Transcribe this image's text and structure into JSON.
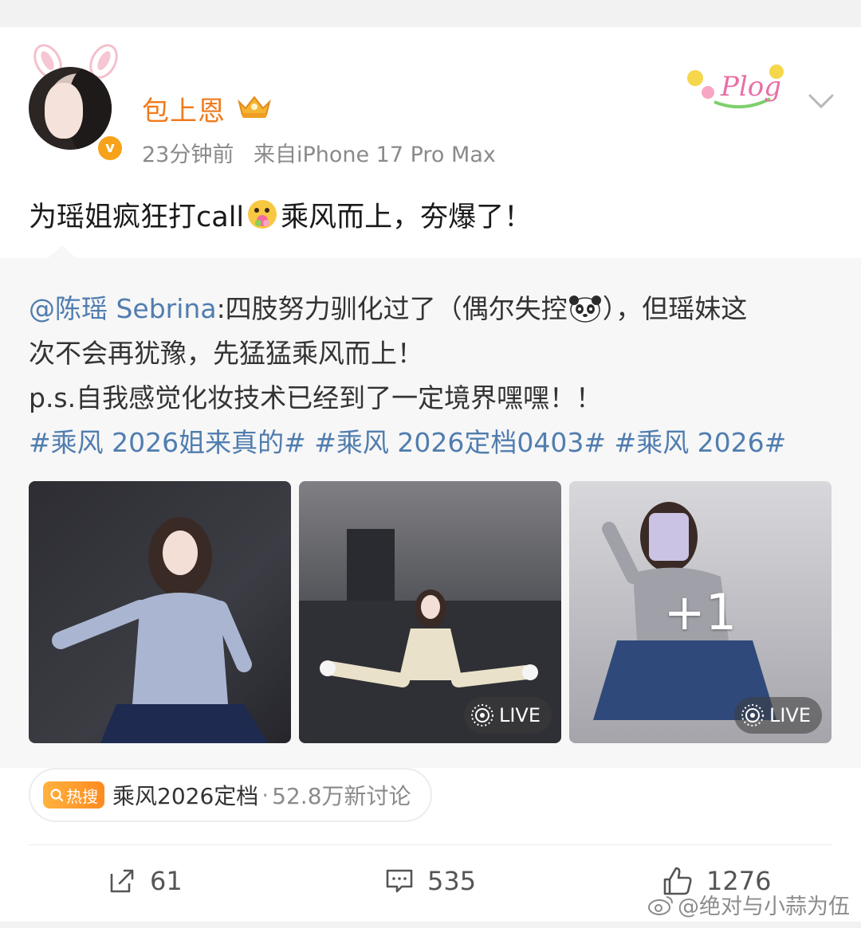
{
  "author": {
    "name": "包上恩",
    "verified": true,
    "time": "23分钟前",
    "source": "来自iPhone 17 Pro Max"
  },
  "post": {
    "text_before_emoji": "为瑶姐疯狂打call",
    "text_after_emoji": "乘风而上，夯爆了！",
    "emoji": "face-with-flowers-emoji"
  },
  "repost": {
    "mention": "@陈瑶 Sebrina",
    "line1_text": ":四肢努力驯化过了（偶尔失控",
    "line1_end": "），但瑶妹这",
    "line2": "次不会再犹豫，先猛猛乘风而上！",
    "line3": "p.s.自我感觉化妆技术已经到了一定境界嘿嘿！！",
    "hashtags": [
      "#乘风 2026姐来真的#",
      "#乘风 2026定档0403#",
      "#乘风 2026#"
    ],
    "photos": [
      {
        "alt": "dancer-photo",
        "live": false
      },
      {
        "alt": "stretching-photo",
        "live": true,
        "live_label": "LIVE"
      },
      {
        "alt": "mirror-selfie-photo",
        "live": true,
        "live_label": "LIVE",
        "more": "+1"
      }
    ]
  },
  "hot_search": {
    "tag": "热搜",
    "title": "乘风2026定档",
    "separator": "·",
    "count": "52.8万新讨论"
  },
  "actions": {
    "repost_count": "61",
    "comment_count": "535",
    "like_count": "1276"
  },
  "watermark": "@绝对与小蒜为伍",
  "colors": {
    "username": "#f07a1b",
    "link": "#507daf",
    "hot_tag": "#ff8a1f"
  }
}
